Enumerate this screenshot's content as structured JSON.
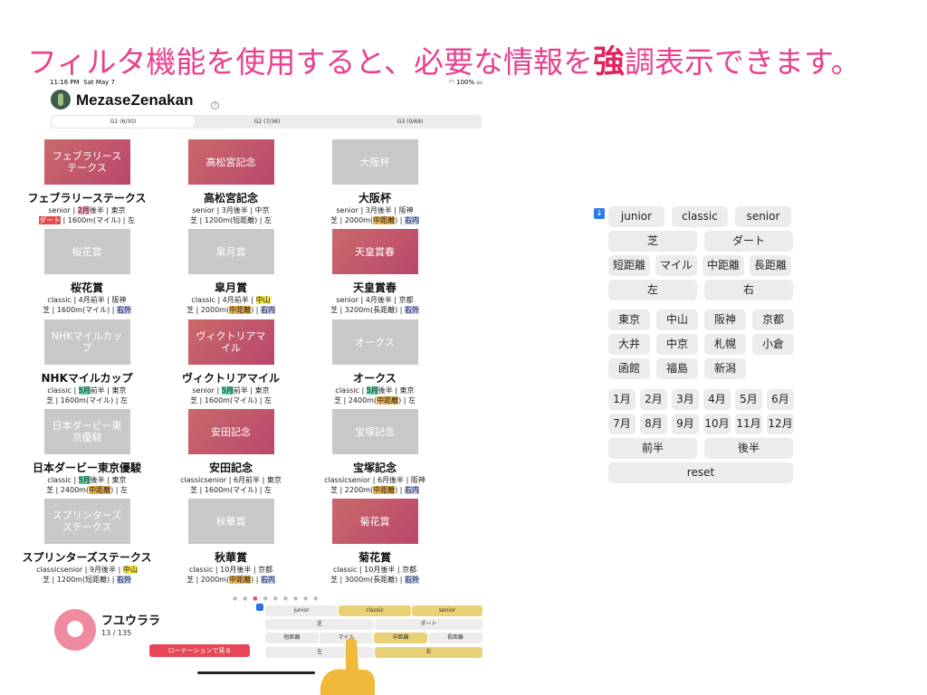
{
  "headline": {
    "before": "フィルタ機能を使用すると、必要な情報を",
    "accent": "強",
    "after": "調表示できます。"
  },
  "status": {
    "time": "11:16 PM",
    "date": "Sat May 7",
    "battery": "100%"
  },
  "app": {
    "title": "MezaseZenakan",
    "help": "?"
  },
  "tabs": [
    "G1 (6/30)",
    "G2 (7/36)",
    "G3 (0/69)"
  ],
  "races": [
    {
      "thumb": "フェブラリーステークス",
      "name": "フェブラリーステークス",
      "l1a": "senior | ",
      "l1h": "2月",
      "l1b": "後半 | 東京",
      "l2a": "",
      "l2h": "ダート",
      "l2b": " | 1600m(マイル) | 左"
    },
    {
      "thumb": "高松宮記念",
      "name": "高松宮記念",
      "l1a": "senior | 3月後半 | 中京",
      "l1h": "",
      "l1b": "",
      "l2a": "芝 | 1200m(短距離) | 左",
      "l2h": "",
      "l2b": ""
    },
    {
      "thumb": "大阪杯",
      "name": "大阪杯",
      "l1a": "senior | 3月後半 | 阪神",
      "l1h": "",
      "l1b": "",
      "l2a": "芝 | 2000m(",
      "l2h": "中距離",
      "l2b": ") | ",
      "l2h2": "右内"
    },
    {
      "thumb": "桜花賞",
      "name": "桜花賞",
      "l1a": "classic | 4月前半 | 阪神",
      "l1h": "",
      "l1b": "",
      "l2a": "芝 | 1600m(マイル) | ",
      "l2h": "",
      "l2b": "",
      "l2h2": "右外"
    },
    {
      "thumb": "皐月賞",
      "name": "皐月賞",
      "l1a": "classic | 4月前半 | ",
      "l1h": "中山",
      "l1b": "",
      "l2a": "芝 | 2000m(",
      "l2h": "中距離",
      "l2b": ") | ",
      "l2h2": "右内"
    },
    {
      "thumb": "天皇賞春",
      "name": "天皇賞春",
      "l1a": "senior | 4月後半 | 京都",
      "l1h": "",
      "l1b": "",
      "l2a": "芝 | 3200m(長距離) | ",
      "l2h": "",
      "l2b": "",
      "l2h2": "右外"
    },
    {
      "thumb": "NHKマイルカップ",
      "name": "NHKマイルカップ",
      "l1a": "classic | ",
      "l1h": "5月",
      "l1b": "前半 | 東京",
      "l2a": "芝 | 1600m(マイル) | 左",
      "l2h": "",
      "l2b": ""
    },
    {
      "thumb": "ヴィクトリアマイル",
      "name": "ヴィクトリアマイル",
      "l1a": "senior | ",
      "l1h": "5月",
      "l1b": "前半 | 東京",
      "l2a": "芝 | 1600m(マイル) | 左",
      "l2h": "",
      "l2b": ""
    },
    {
      "thumb": "オークス",
      "name": "オークス",
      "l1a": "classic | ",
      "l1h": "5月",
      "l1b": "後半 | 東京",
      "l2a": "芝 | 2400m(",
      "l2h": "中距離",
      "l2b": ") | 左"
    },
    {
      "thumb": "日本ダービー東京優駿",
      "name": "日本ダービー東京優駿",
      "l1a": "classic | ",
      "l1h": "5月",
      "l1b": "後半 | 東京",
      "l2a": "芝 | 2400m(",
      "l2h": "中距離",
      "l2b": ") | 左"
    },
    {
      "thumb": "安田記念",
      "name": "安田記念",
      "l1a": "classicsenior | 6月前半 | 東京",
      "l1h": "",
      "l1b": "",
      "l2a": "芝 | 1600m(マイル) | 左",
      "l2h": "",
      "l2b": ""
    },
    {
      "thumb": "宝塚記念",
      "name": "宝塚記念",
      "l1a": "classicsenior | 6月後半 | 阪神",
      "l1h": "",
      "l1b": "",
      "l2a": "芝 | 2200m(",
      "l2h": "中距離",
      "l2b": ") | ",
      "l2h2": "右内"
    },
    {
      "thumb": "スプリンターズステークス",
      "name": "スプリンターズステークス",
      "l1a": "classicsenior | 9月後半 | ",
      "l1h": "中山",
      "l1b": "",
      "l2a": "芝 | 1200m(短距離) | ",
      "l2h": "",
      "l2b": "",
      "l2h2": "右外"
    },
    {
      "thumb": "秋華賞",
      "name": "秋華賞",
      "l1a": "classic | 10月後半 | 京都",
      "l1h": "",
      "l1b": "",
      "l2a": "芝 | 2000m(",
      "l2h": "中距離",
      "l2b": ") | ",
      "l2h2": "右内"
    },
    {
      "thumb": "菊花賞",
      "name": "菊花賞",
      "l1a": "classic | 10月後半 | 京都",
      "l1h": "",
      "l1b": "",
      "l2a": "芝 | 3000m(長距離) | ",
      "l2h": "",
      "l2b": "",
      "l2h2": "右外"
    }
  ],
  "profile": {
    "name": "フユウララ",
    "count": "13 / 135",
    "rotation_button": "ローテーションで見る"
  },
  "mini_filter": [
    "junior",
    "classic",
    "senior",
    "芝",
    "ダート",
    "短距離",
    "マイル",
    "中距離",
    "長距離",
    "左",
    "右"
  ],
  "filter": {
    "age": [
      "junior",
      "classic",
      "senior"
    ],
    "surface": [
      "芝",
      "ダート"
    ],
    "distance": [
      "短距離",
      "マイル",
      "中距離",
      "長距離"
    ],
    "direction": [
      "左",
      "右"
    ],
    "tracks": [
      "東京",
      "中山",
      "阪神",
      "京都",
      "大井",
      "中京",
      "札幌",
      "小倉",
      "函館",
      "福島",
      "新潟"
    ],
    "months": [
      "1月",
      "2月",
      "3月",
      "4月",
      "5月",
      "6月",
      "7月",
      "8月",
      "9月",
      "10月",
      "11月",
      "12月"
    ],
    "halves": [
      "前半",
      "後半"
    ],
    "reset": "reset"
  },
  "colors": {
    "headline": "#e8408f",
    "g1_thumb": "#c05a6b",
    "highlight_orange": "#f0b34c",
    "active_chip": "#e9d175"
  }
}
